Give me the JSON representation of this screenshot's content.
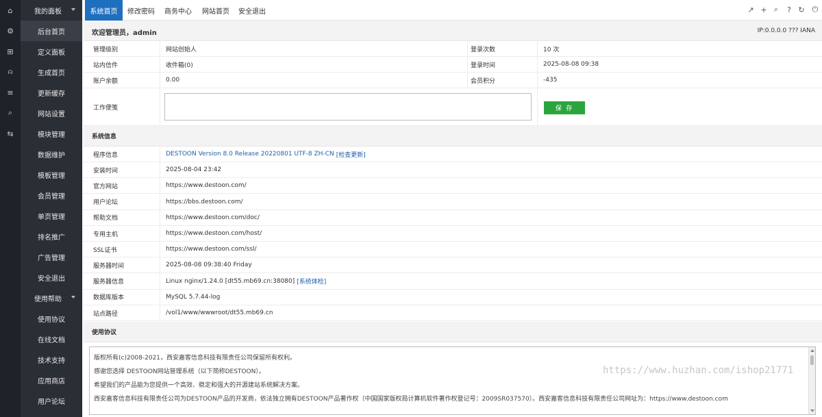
{
  "rail": [
    {
      "icon": "home-icon",
      "glyph": "⌂"
    },
    {
      "icon": "settings-icon",
      "glyph": "⚙"
    },
    {
      "icon": "grid-icon",
      "glyph": "⊞"
    },
    {
      "icon": "user-icon",
      "glyph": "⍝"
    },
    {
      "icon": "list-icon",
      "glyph": "≡"
    },
    {
      "icon": "search-icon",
      "glyph": "⌕"
    },
    {
      "icon": "exchange-icon",
      "glyph": "⇆"
    }
  ],
  "sidebar": {
    "group1": "我的面板",
    "items": [
      "后台首页",
      "定义面板",
      "生成首页",
      "更新缓存",
      "网站设置",
      "模块管理",
      "数据维护",
      "模板管理",
      "会员管理",
      "单页管理",
      "排名推广",
      "广告管理",
      "安全退出"
    ],
    "group2": "使用帮助",
    "items2": [
      "使用协议",
      "在线文档",
      "技术支持",
      "应用商店",
      "用户论坛"
    ]
  },
  "topnav": {
    "tabs": [
      "系统首页",
      "修改密码",
      "商务中心",
      "网站首页",
      "安全退出"
    ],
    "tools": [
      {
        "icon": "external-link-icon",
        "glyph": "↗"
      },
      {
        "icon": "plus-icon",
        "glyph": "+"
      },
      {
        "icon": "search-icon",
        "glyph": "⌕"
      },
      {
        "icon": "help-icon",
        "glyph": "?"
      },
      {
        "icon": "refresh-icon",
        "glyph": "↻"
      },
      {
        "icon": "power-icon",
        "glyph": "⏻"
      }
    ]
  },
  "welcome": {
    "text": "欢迎管理员，admin",
    "ip": "IP:0.0.0.0 ??? IANA"
  },
  "account": {
    "level_label": "管理级别",
    "level_value": "网站创始人",
    "logins_label": "登录次数",
    "logins_value": "10 次",
    "messages_label": "站内信件",
    "messages_value": "收件箱(0)",
    "login_time_label": "登录时间",
    "login_time_value": "2025-08-08 09:38",
    "balance_label": "账户余额",
    "balance_value": "0.00",
    "points_label": "会员积分",
    "points_value": "-435",
    "note_label": "工作便笺",
    "save_label": "保 存"
  },
  "sysinfo": {
    "title": "系统信息",
    "rows": [
      {
        "label": "程序信息",
        "value": "DESTOON Version 8.0 Release 20220801 UTF-8 ZH-CN",
        "link": "[检查更新]"
      },
      {
        "label": "安装时间",
        "value": "2025-08-04 23:42",
        "link": ""
      },
      {
        "label": "官方网站",
        "value": "https://www.destoon.com/",
        "link": ""
      },
      {
        "label": "用户论坛",
        "value": "https://bbs.destoon.com/",
        "link": ""
      },
      {
        "label": "帮助文档",
        "value": "https://www.destoon.com/doc/",
        "link": ""
      },
      {
        "label": "专用主机",
        "value": "https://www.destoon.com/host/",
        "link": ""
      },
      {
        "label": "SSL证书",
        "value": "https://www.destoon.com/ssl/",
        "link": ""
      },
      {
        "label": "服务器时间",
        "value": "2025-08-08 09:38:40 Friday",
        "link": ""
      },
      {
        "label": "服务器信息",
        "value": "Linux nginx/1.24.0 [dt55.mb69.cn:38080]",
        "link": "[系统体检]"
      },
      {
        "label": "数据库版本",
        "value": "MySQL 5.7.44-log",
        "link": ""
      },
      {
        "label": "站点路径",
        "value": "/vol1/www/wwwroot/dt55.mb69.cn",
        "link": ""
      }
    ]
  },
  "agreement": {
    "title": "使用协议",
    "lines": [
      "版权所有(c)2008-2021，西安嘉客信息科技有限责任公司保留所有权利。",
      "感谢您选择 DESTOON网站管理系统（以下简称DESTOON）。",
      "希望我们的产品能为您提供一个高效、稳定和强大的开源建站系统解决方案。",
      "西安嘉客信息科技有限责任公司为DESTOON产品的开发商，依法独立拥有DESTOON产品著作权（中国国家版权局计算机软件著作权登记号：2009SR037570）。西安嘉客信息科技有限责任公司网址为：https://www.destoon.com"
    ]
  },
  "watermark": "https://www.huzhan.com/ishop21771"
}
